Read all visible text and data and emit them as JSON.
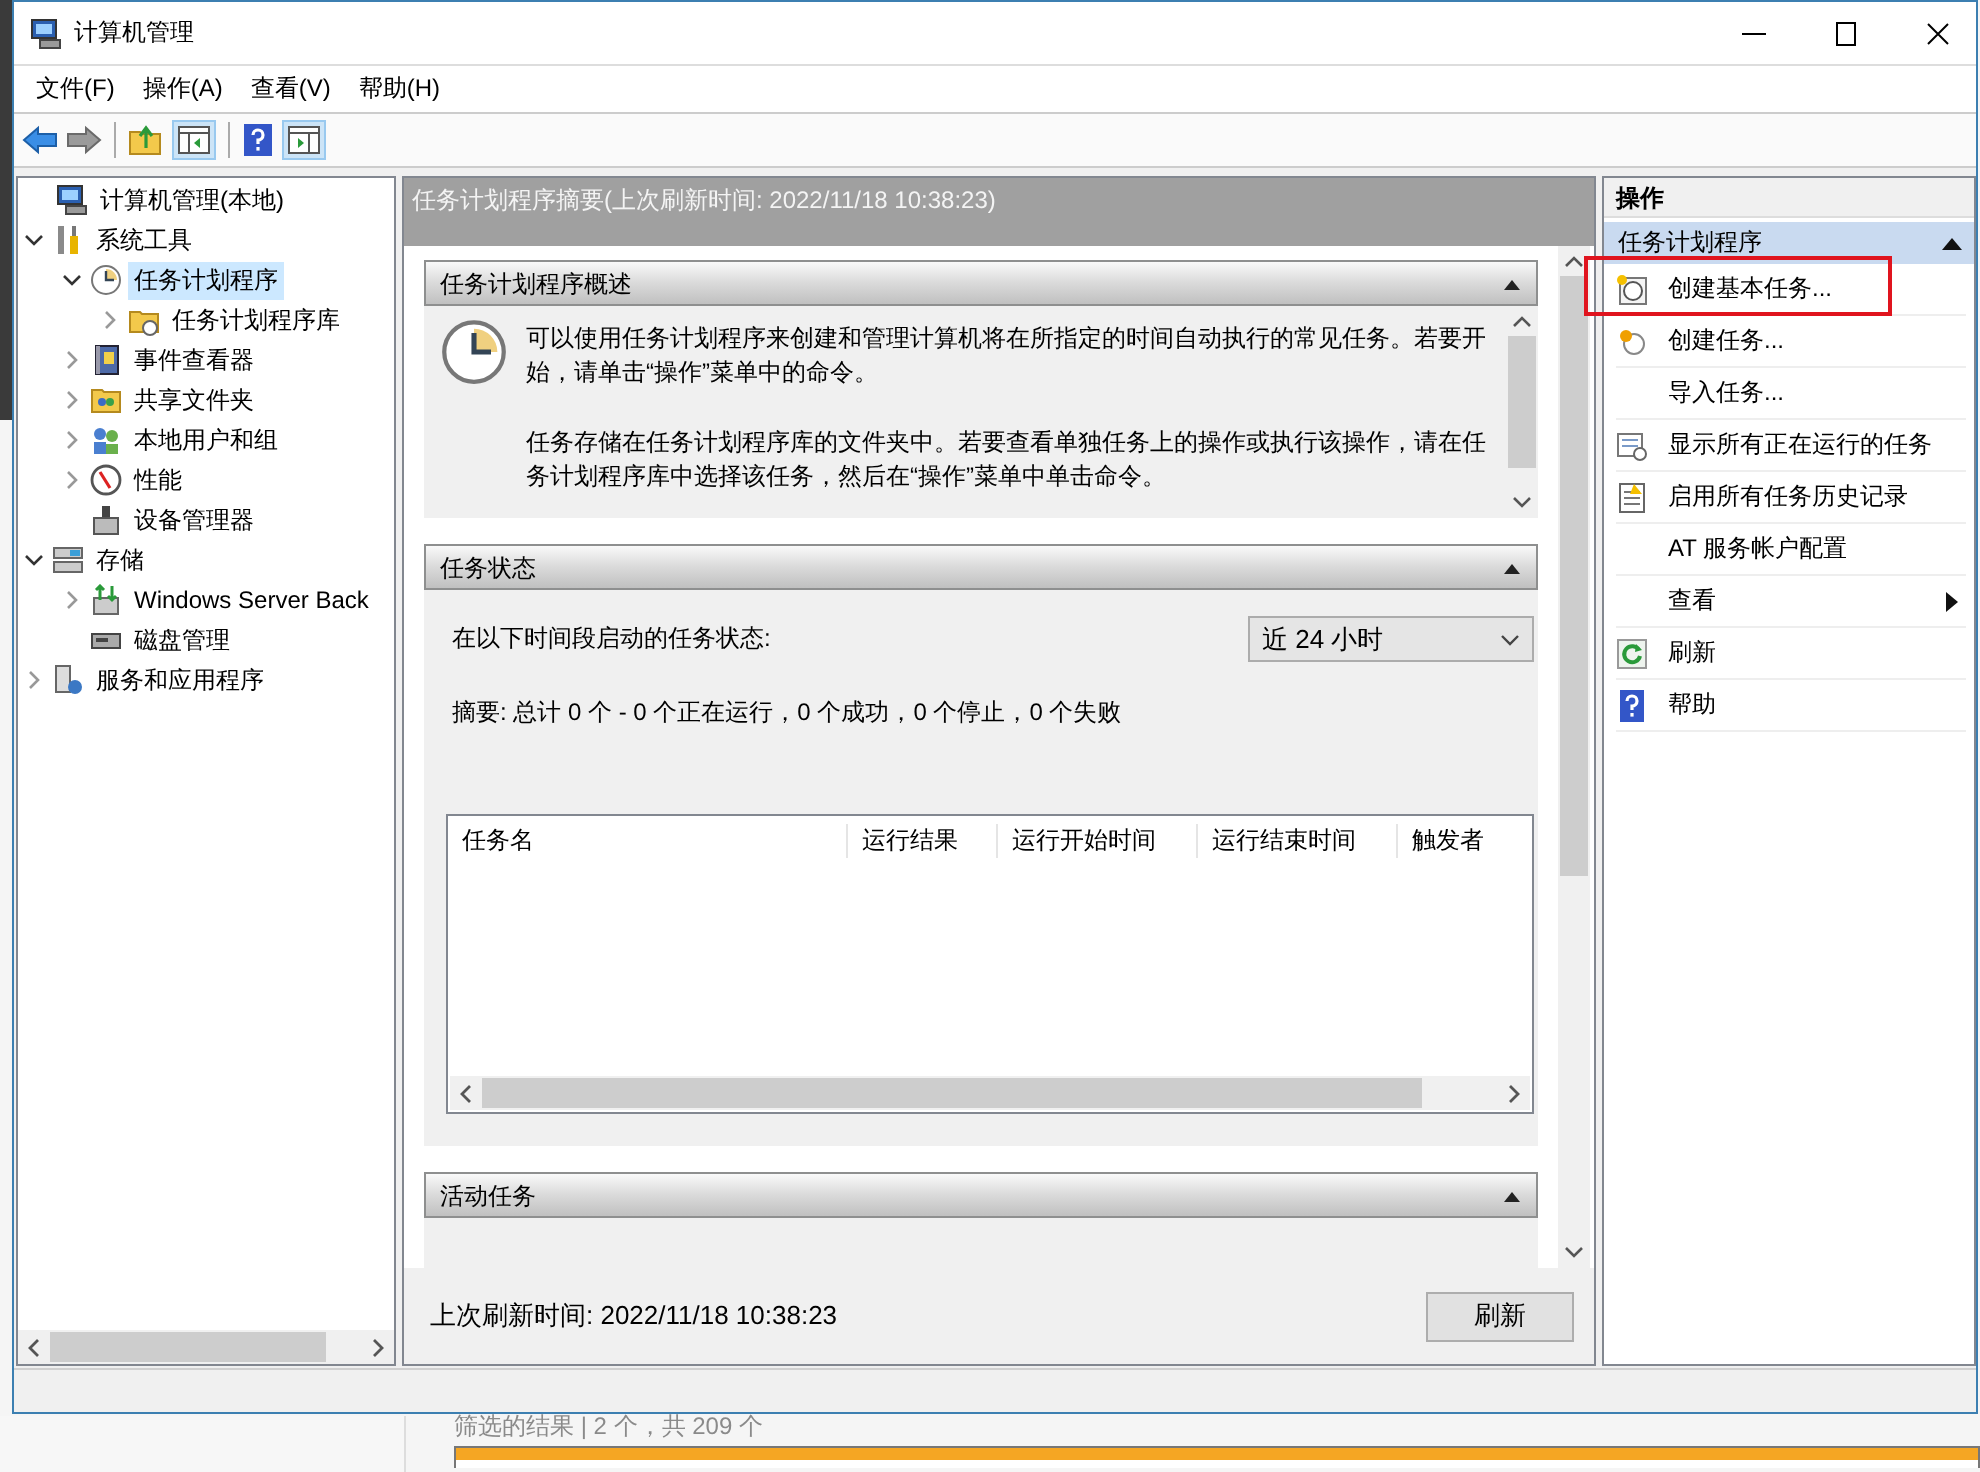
{
  "window": {
    "title": "计算机管理"
  },
  "menu": [
    "文件(F)",
    "操作(A)",
    "查看(V)",
    "帮助(H)"
  ],
  "tree": [
    {
      "label": "计算机管理(本地)",
      "selected": false,
      "children": [
        {
          "label": "系统工具",
          "expanded": true,
          "selected": false,
          "children": [
            {
              "label": "任务计划程序",
              "expanded": true,
              "selected": true,
              "children": [
                {
                  "label": "任务计划程序库",
                  "expanded": false,
                  "selected": false
                }
              ]
            },
            {
              "label": "事件查看器",
              "expanded": false,
              "selected": false
            },
            {
              "label": "共享文件夹",
              "expanded": false,
              "selected": false
            },
            {
              "label": "本地用户和组",
              "expanded": false,
              "selected": false
            },
            {
              "label": "性能",
              "expanded": false,
              "selected": false
            },
            {
              "label": "设备管理器",
              "selected": false
            }
          ]
        },
        {
          "label": "存储",
          "expanded": true,
          "selected": false,
          "children": [
            {
              "label": "Windows Server Back",
              "expanded": false,
              "selected": false
            },
            {
              "label": "磁盘管理",
              "selected": false
            }
          ]
        },
        {
          "label": "服务和应用程序",
          "expanded": false,
          "selected": false
        }
      ]
    }
  ],
  "center": {
    "header": "任务计划程序摘要(上次刷新时间: 2022/11/18 10:38:23)",
    "sections": [
      {
        "kind": "overview",
        "title": "任务计划程序概述",
        "expanded": true,
        "paragraphs": [
          "可以使用任务计划程序来创建和管理计算机将在所指定的时间自动执行的常见任务。若要开始，请单击“操作”菜单中的命令。",
          "任务存储在任务计划程序库的文件夹中。若要查看单独任务上的操作或执行该操作，请在任务计划程序库中选择该任务，然后在“操作”菜单中单击命令。"
        ]
      },
      {
        "kind": "status",
        "title": "任务状态",
        "expanded": true,
        "period_label": "在以下时间段启动的任务状态:",
        "period": "近 24 小时",
        "summary": "摘要: 总计 0 个 - 0 个正在运行，0 个成功，0 个停止，0 个失败",
        "columns": [
          "任务名",
          "运行结果",
          "运行开始时间",
          "运行结束时间",
          "触发者"
        ]
      },
      {
        "kind": "active",
        "title": "活动任务",
        "expanded": true
      }
    ],
    "footer": {
      "refreshed": "上次刷新时间: 2022/11/18 10:38:23",
      "button": "刷新"
    }
  },
  "actions": {
    "title": "操作",
    "groups": [
      {
        "title": "任务计划程序",
        "expanded": true,
        "items": [
          {
            "label": "创建基本任务...",
            "kind": "action",
            "highlighted": true
          },
          {
            "label": "创建任务...",
            "kind": "action",
            "highlighted": false
          },
          {
            "label": "导入任务...",
            "kind": "action",
            "highlighted": false
          },
          {
            "label": "显示所有正在运行的任务",
            "kind": "action",
            "highlighted": false
          },
          {
            "label": "启用所有任务历史记录",
            "kind": "action",
            "highlighted": false
          },
          {
            "label": "AT 服务帐户配置",
            "kind": "action",
            "highlighted": false
          },
          {
            "label": "查看",
            "kind": "submenu",
            "highlighted": false
          },
          {
            "label": "刷新",
            "kind": "action",
            "highlighted": false
          },
          {
            "label": "帮助",
            "kind": "action",
            "highlighted": false
          }
        ]
      }
    ]
  },
  "background": {
    "filter": "筛选的结果 | 2 个，共 209 个"
  }
}
